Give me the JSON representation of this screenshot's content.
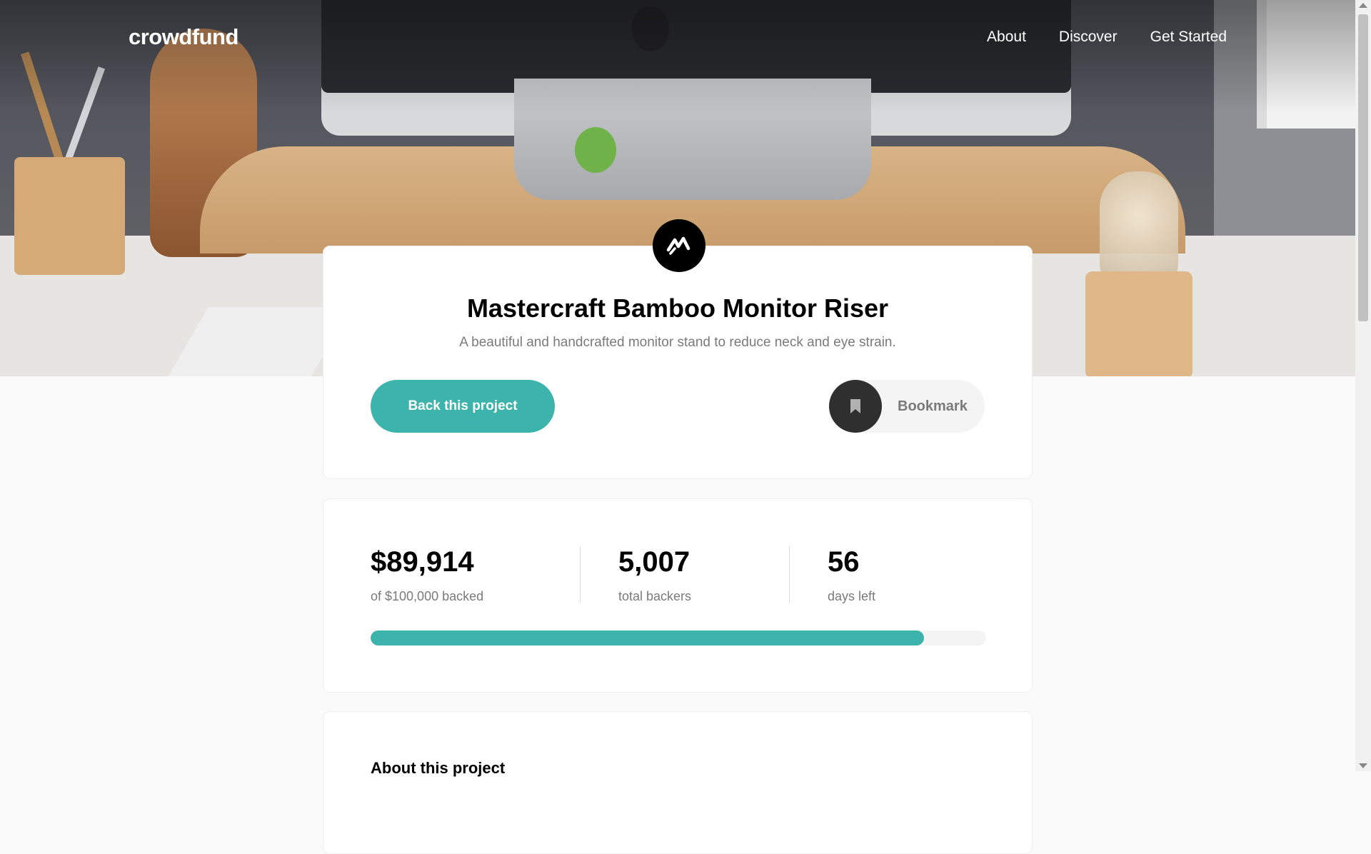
{
  "header": {
    "logo": "crowdfund",
    "nav": [
      {
        "label": "About"
      },
      {
        "label": "Discover"
      },
      {
        "label": "Get Started"
      }
    ]
  },
  "project": {
    "title": "Mastercraft Bamboo Monitor Riser",
    "subtitle": "A beautiful and handcrafted monitor stand to reduce neck and eye strain.",
    "back_button": "Back this project",
    "bookmark_label": "Bookmark",
    "logo_icon": "mastercraft-logo-icon"
  },
  "stats": {
    "backed_amount": "$89,914",
    "backed_label": "of $100,000 backed",
    "backers_count": "5,007",
    "backers_label": "total backers",
    "days_count": "56",
    "days_label": "days left",
    "progress_fraction": 0.899
  },
  "about": {
    "title": "About this project"
  },
  "colors": {
    "accent": "#3cb4ac",
    "text_dark": "#000000",
    "text_muted": "#7a7a7a",
    "bookmark_icon_bg": "#2f2f2f"
  }
}
